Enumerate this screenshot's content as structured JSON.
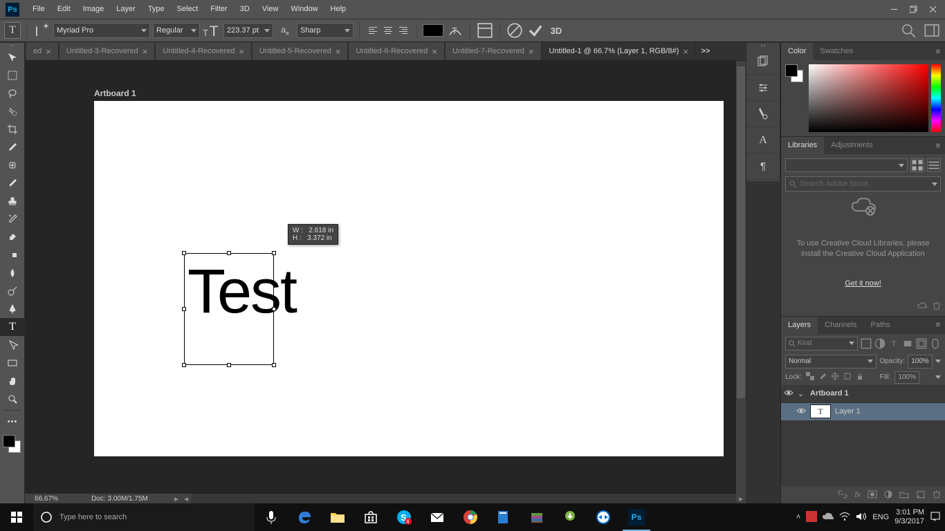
{
  "menu": [
    "File",
    "Edit",
    "Image",
    "Layer",
    "Type",
    "Select",
    "Filter",
    "3D",
    "View",
    "Window",
    "Help"
  ],
  "options": {
    "tool_glyph": "T",
    "font_family": "Myriad Pro",
    "font_style": "Regular",
    "font_size": "223.37 pt",
    "aa_label": "a",
    "aa_mode": "Sharp",
    "threeD": "3D"
  },
  "tabs": [
    {
      "label": "ed",
      "close": true
    },
    {
      "label": "Untitled-3-Recovered",
      "close": true
    },
    {
      "label": "Untitled-4-Recovered",
      "close": true
    },
    {
      "label": "Untitled-5-Recovered",
      "close": true
    },
    {
      "label": "Untitled-6-Recovered",
      "close": true
    },
    {
      "label": "Untitled-7-Recovered",
      "close": true
    },
    {
      "label": "Untitled-1 @ 66.7% (Layer 1, RGB/8#)",
      "close": true,
      "active": true
    }
  ],
  "tabs_more": ">>",
  "canvas": {
    "artboard_label": "Artboard 1",
    "text_content": "Test",
    "tooltip_w_label": "W :",
    "tooltip_w_val": "2.618 in",
    "tooltip_h_label": "H :",
    "tooltip_h_val": "3.372 in",
    "zoom": "66.67%",
    "doc_status": "Doc: 3.00M/1.75M"
  },
  "rightstrip_more": ">>",
  "panels": {
    "color": {
      "tab_color": "Color",
      "tab_swatches": "Swatches"
    },
    "libraries": {
      "tab_lib": "Libraries",
      "tab_adj": "Adjustments",
      "search_placeholder": "Search Adobe Stock",
      "msg": "To use Creative Cloud Libraries, please install the Creative Cloud Application",
      "link": "Get it now!"
    },
    "layers": {
      "tab_layers": "Layers",
      "tab_channels": "Channels",
      "tab_paths": "Paths",
      "filter_kind": "Kind",
      "blend": "Normal",
      "opacity_label": "Opacity:",
      "opacity_val": "100%",
      "lock_label": "Lock:",
      "fill_label": "Fill:",
      "fill_val": "100%",
      "items": [
        {
          "name": "Artboard 1",
          "kind": "group"
        },
        {
          "name": "Layer 1",
          "kind": "text"
        }
      ]
    }
  },
  "taskbar": {
    "search_placeholder": "Type here to search",
    "lang": "ENG",
    "time": "3:01 PM",
    "date": "9/3/2017"
  }
}
